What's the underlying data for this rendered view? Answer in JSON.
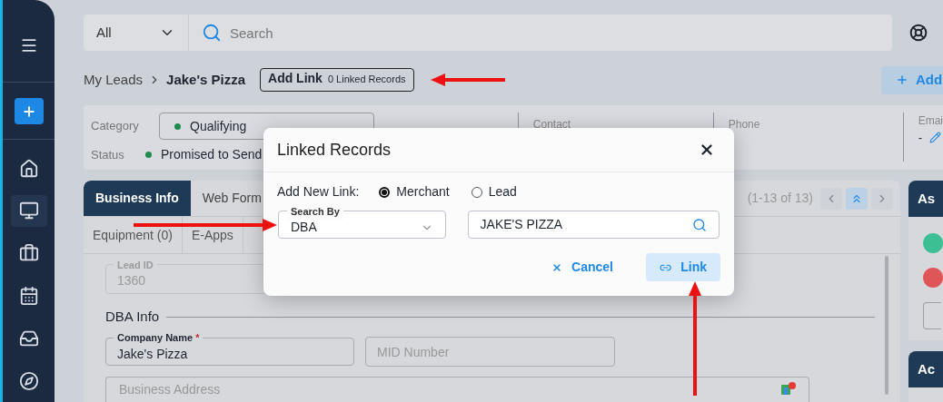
{
  "search_bar": {
    "scope": "All",
    "placeholder": "Search"
  },
  "breadcrumb": {
    "parent": "My Leads",
    "current": "Jake's Pizza"
  },
  "add_link_button": {
    "label": "Add Link",
    "count": "0 Linked Records"
  },
  "add_button": {
    "label": "Add"
  },
  "summary": {
    "category_label": "Category",
    "category": "Qualifying",
    "status_label": "Status",
    "status": "Promised to Send",
    "contact_label": "Contact",
    "phone_label": "Phone",
    "email_label": "Emai",
    "email": "-"
  },
  "tabs": [
    {
      "label": "Business Info",
      "selected": true
    },
    {
      "label": "Web Form",
      "selected": false
    }
  ],
  "subtabs": [
    "Equipment (0)",
    "E-Apps"
  ],
  "pager": {
    "range": "(1-13 of 13)"
  },
  "form": {
    "lead_id": {
      "label": "Lead ID",
      "value": "1360",
      "disabled": true
    },
    "section": "DBA Info",
    "company": {
      "label": "Company Name",
      "value": "Jake's Pizza",
      "required_mark": "*"
    },
    "mid": {
      "placeholder": "MID Number"
    },
    "address": {
      "placeholder": "Business Address"
    }
  },
  "side_panels": [
    {
      "title": "As"
    },
    {
      "title": "Ac"
    }
  ],
  "dialog": {
    "title": "Linked Records",
    "add_new_label": "Add New Link:",
    "link_types": [
      {
        "label": "Merchant",
        "selected": true
      },
      {
        "label": "Lead",
        "selected": false
      }
    ],
    "search_by": {
      "label": "Search By",
      "value": "DBA"
    },
    "search": {
      "value": "JAKE'S PIZZA"
    },
    "buttons": [
      {
        "kind": "cancel",
        "label": "Cancel"
      },
      {
        "kind": "link",
        "label": "Link"
      }
    ]
  }
}
